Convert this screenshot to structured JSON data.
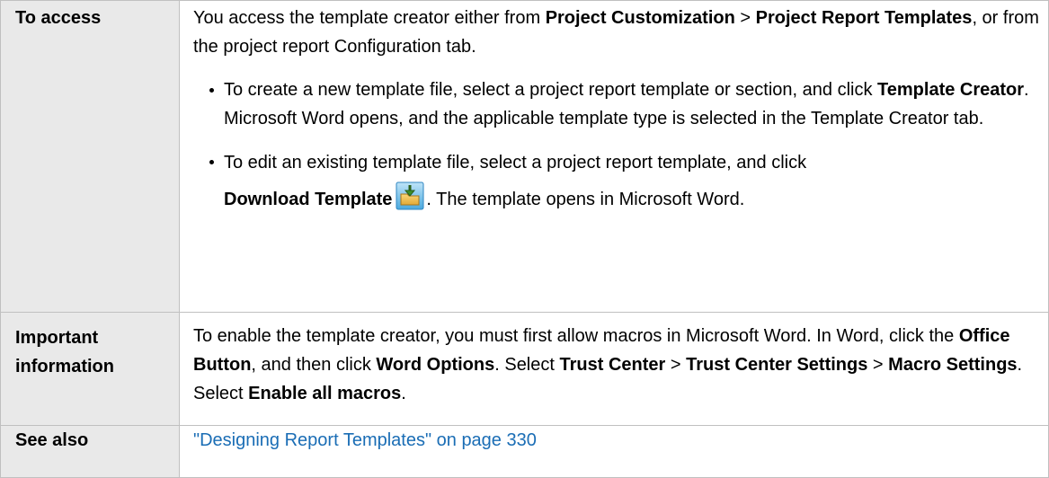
{
  "rows": {
    "access": {
      "header": "To access",
      "intro": {
        "t1": "You access the template creator either from ",
        "b1": "Project Customization",
        "t2": " > ",
        "b2": "Project Report Templates",
        "t3": ", or from the project report Configuration tab."
      },
      "bullet1": {
        "t1": "To create a new template file, select a project report template or section, and click ",
        "b1": "Template Creator",
        "t2": ". Microsoft Word opens, and the applicable template type is selected in the Template Creator tab."
      },
      "bullet2": {
        "t1": "To edit an existing template file, select a project report template, and click",
        "b1": "Download Template",
        "t2": ". The template opens in Microsoft Word.",
        "icon": "download-template-icon"
      }
    },
    "important": {
      "header": "Important information",
      "t1": "To enable the template creator, you must first allow macros in Microsoft Word. In Word, click the ",
      "b1": "Office Button",
      "t2": ", and then click ",
      "b2": "Word Options",
      "t3": ". Select ",
      "b3": "Trust Center",
      "t4": " > ",
      "b4": "Trust Center Settings",
      "t5": " > ",
      "b5": "Macro Settings",
      "t6": ". Select ",
      "b6": "Enable all macros",
      "t7": "."
    },
    "see_also": {
      "header": "See also",
      "link": "\"Designing Report Templates\" on page 330"
    }
  },
  "colors": {
    "header_bg": "#e9e9e9",
    "border": "#c0c0c0",
    "link": "#1a6db5"
  }
}
